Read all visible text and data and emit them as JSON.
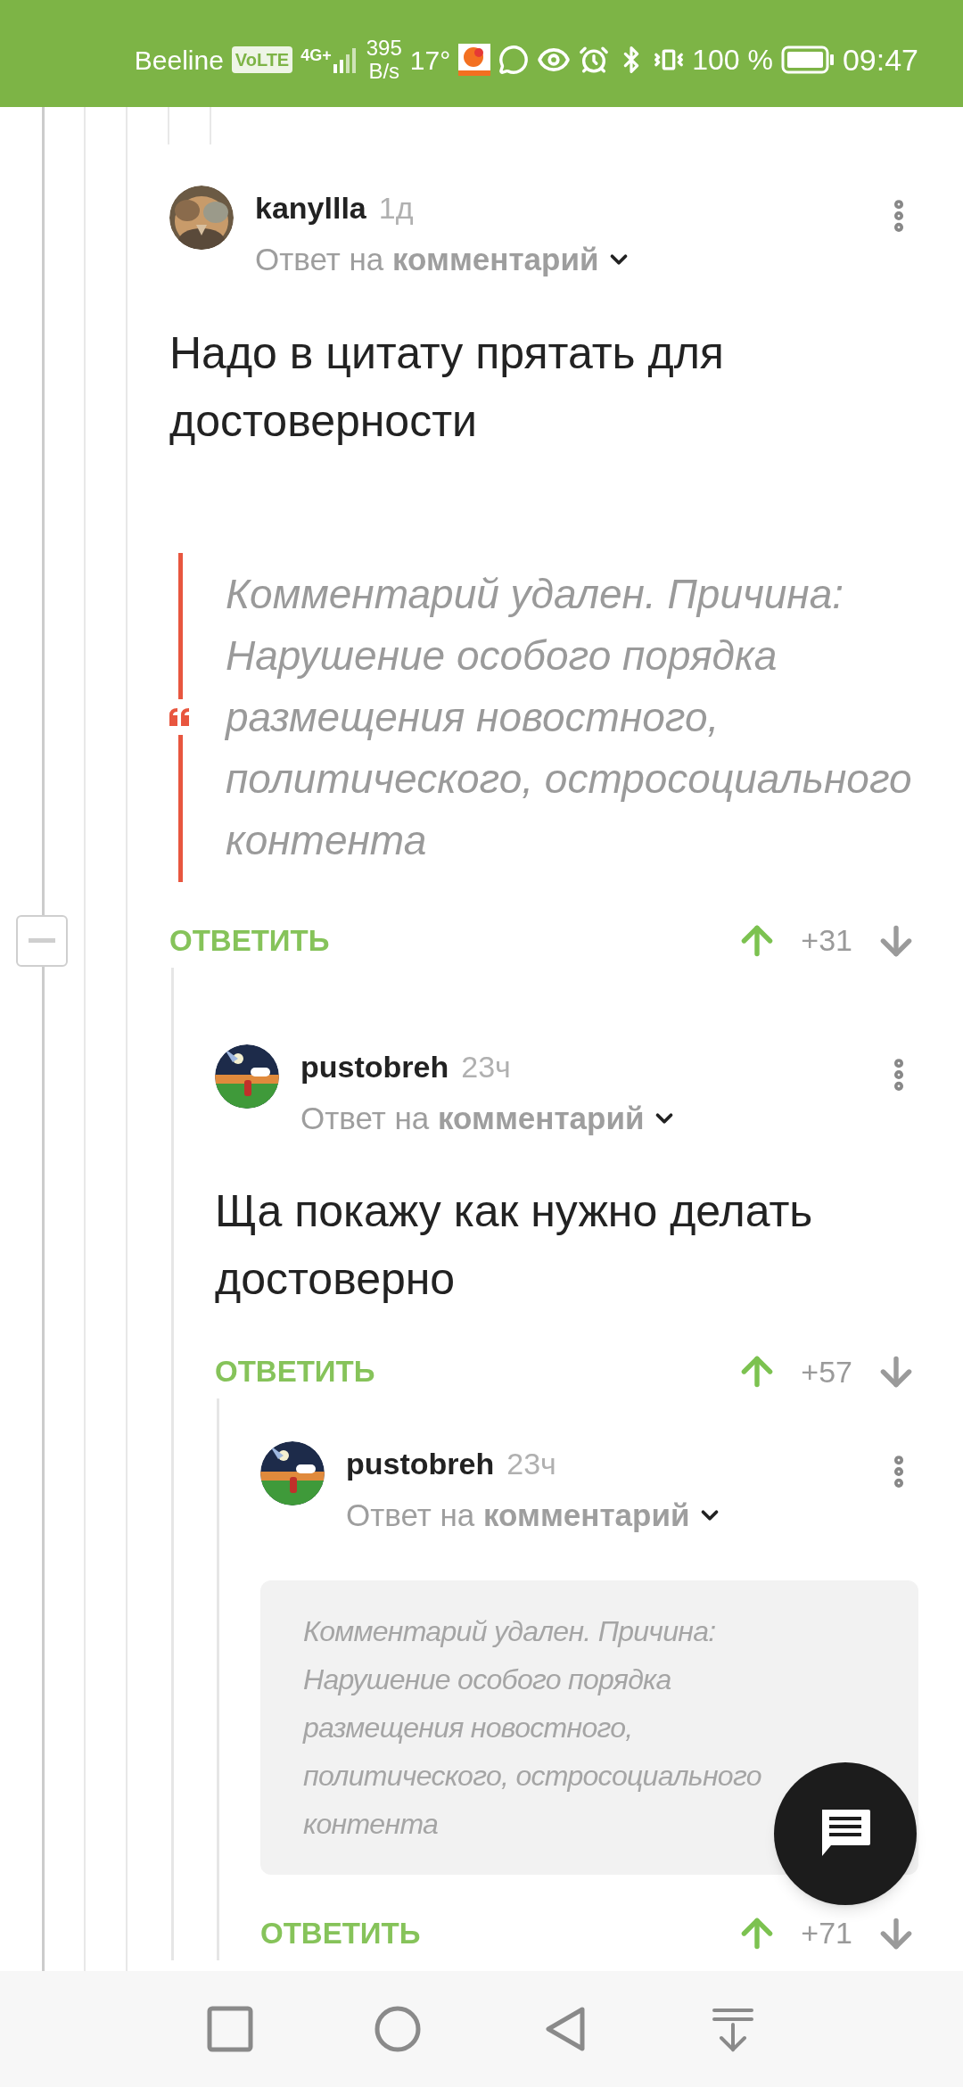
{
  "status_bar": {
    "carrier": "Beeline",
    "volte": "VoLTE",
    "network": "4G+",
    "speed": "395",
    "speed_unit": "B/s",
    "temperature": "17°",
    "battery": "100 %",
    "time": "09:47"
  },
  "comments": [
    {
      "author": "kanyllla",
      "time": "1д",
      "reply_to": "Ответ на **комментарий**",
      "expanded": true,
      "blocks": [
        {
          "kind": "paragraph",
          "text": "Надо в цитату прятать для достоверности"
        },
        {
          "kind": "quote",
          "text": "Комментарий удален. Причина: Нарушение особого порядка размещения новостного, политического, остросоциального контента"
        }
      ],
      "reply": "ОТВЕТИТЬ",
      "score": "+31",
      "children": [
        {
          "author": "pustobreh",
          "time": "23ч",
          "reply_to": "Ответ на **комментарий**",
          "blocks": [
            {
              "kind": "paragraph",
              "text": "Ща покажу как нужно делать достоверно"
            }
          ],
          "reply": "ОТВЕТИТЬ",
          "score": "+57",
          "children": [
            {
              "author": "pustobreh",
              "time": "23ч",
              "reply_to": "Ответ на **комментарий**",
              "blocks": [
                {
                  "kind": "deleted",
                  "text": "Комментарий удален. Причина: Нарушение особого порядка размещения новостного, политического, остросоциального контента"
                }
              ],
              "reply": "ОТВЕТИТЬ",
              "score": "+71"
            }
          ]
        }
      ]
    }
  ]
}
